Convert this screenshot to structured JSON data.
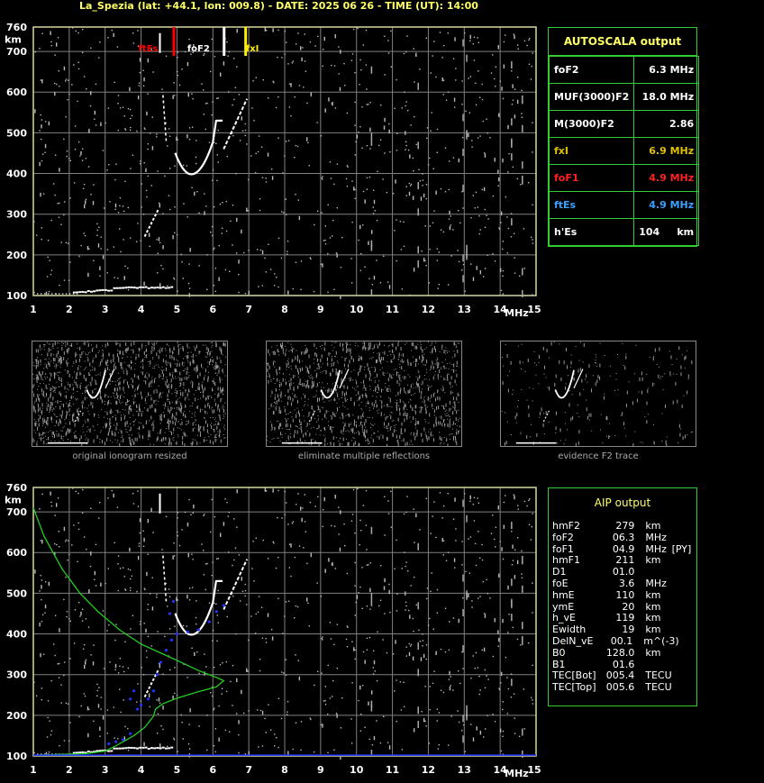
{
  "header": {
    "title": "La_Spezia (lat: +44.1, lon: 009.8) - DATE: 2025 06 26 - TIME (UT): 14:00"
  },
  "axes": {
    "y_unit": "km",
    "x_unit": "MHz",
    "y_ticks": [
      "100",
      "200",
      "300",
      "400",
      "500",
      "600",
      "700",
      "760"
    ],
    "x_ticks": [
      "1",
      "2",
      "3",
      "4",
      "5",
      "6",
      "7",
      "8",
      "9",
      "10",
      "11",
      "12",
      "13",
      "14",
      "15"
    ]
  },
  "markers": {
    "ftEs": "ftEs",
    "foF1": "foF1",
    "foF2": "foF2",
    "fxI": "fxI"
  },
  "autoscala": {
    "title": "AUTOSCALA output",
    "rows": [
      {
        "label": "foF2",
        "value": "6.3 MHz",
        "color": "#ffffff"
      },
      {
        "label": "MUF(3000)F2",
        "value": "18.0 MHz",
        "color": "#ffffff"
      },
      {
        "label": "M(3000)F2",
        "value": "2.86",
        "color": "#ffffff"
      },
      {
        "label": "fxI",
        "value": "6.9 MHz",
        "color": "#e0c000"
      },
      {
        "label": "foF1",
        "value": "4.9 MHz",
        "color": "#ff2020"
      },
      {
        "label": "ftEs",
        "value": "4.9 MHz",
        "color": "#3aa0ff"
      },
      {
        "label": "h'Es",
        "value": "104",
        "unit": "km",
        "color": "#ffffff"
      }
    ]
  },
  "thumbnails": {
    "captions": [
      "original ionogram resized",
      "eliminate multiple reflections",
      "evidence F2 trace"
    ]
  },
  "aip": {
    "title": "AIP output",
    "rows": [
      [
        "hmF2",
        "279",
        "km",
        ""
      ],
      [
        "foF2",
        "06.3",
        "MHz",
        ""
      ],
      [
        "foF1",
        "04.9",
        "MHz",
        "[PY]"
      ],
      [
        "hmF1",
        "211",
        "km",
        ""
      ],
      [
        "D1",
        "01.0",
        "",
        ""
      ],
      [
        "foE",
        "3.6",
        "MHz",
        ""
      ],
      [
        "hmE",
        "110",
        "km",
        ""
      ],
      [
        "ymE",
        "20",
        "km",
        ""
      ],
      [
        "h_vE",
        "119",
        "km",
        ""
      ],
      [
        "Ewidth",
        "19",
        "km",
        ""
      ],
      [
        "DelN_vE",
        "00.1",
        "m^(-3)",
        ""
      ],
      [
        "B0",
        "128.0",
        "km",
        ""
      ],
      [
        "B1",
        "01.6",
        "",
        ""
      ],
      [
        "TEC[Bot]",
        "005.4",
        "TECU",
        ""
      ],
      [
        "TEC[Top]",
        "005.6",
        "TECU",
        ""
      ]
    ]
  },
  "colors": {
    "grid": "#808080",
    "frame": "#d8d8a0",
    "green": "#22cc22",
    "blue": "#2233ff",
    "red": "#ff0000",
    "yellow": "#ffee00"
  }
}
